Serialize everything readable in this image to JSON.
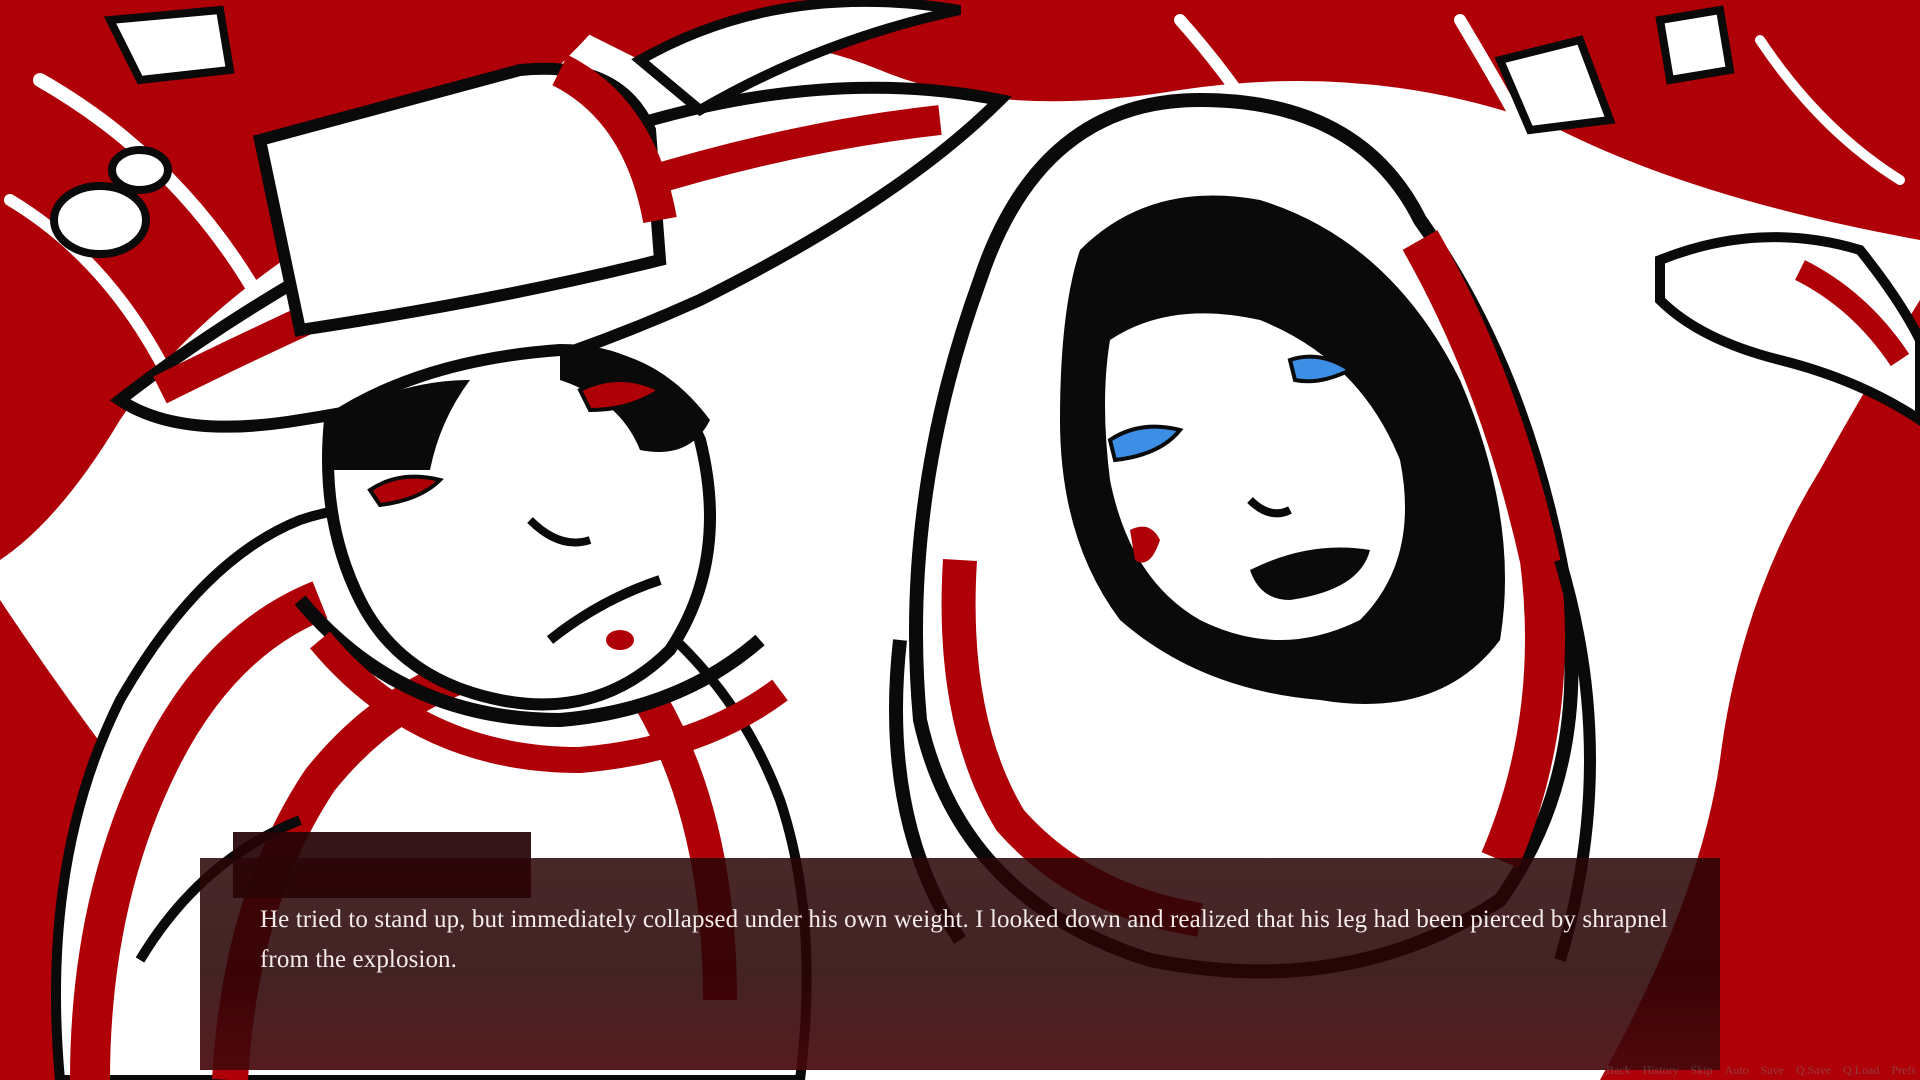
{
  "speaker": {
    "name": ""
  },
  "dialogue": {
    "text": "He tried to stand up, but immediately collapsed under his own weight. I looked down and realized that his leg had been pierced by shrapnel from the explosion."
  },
  "quick_menu": {
    "back": "Back",
    "history": "History",
    "skip": "Skip",
    "auto": "Auto",
    "save": "Save",
    "qsave": "Q.Save",
    "qload": "Q.Load",
    "prefs": "Prefs"
  },
  "palette": {
    "red": "#b00007",
    "black": "#0a0a0a",
    "white": "#ffffff",
    "eye_blue": "#3d8fe6",
    "textbox_dark": "#2a0406"
  }
}
